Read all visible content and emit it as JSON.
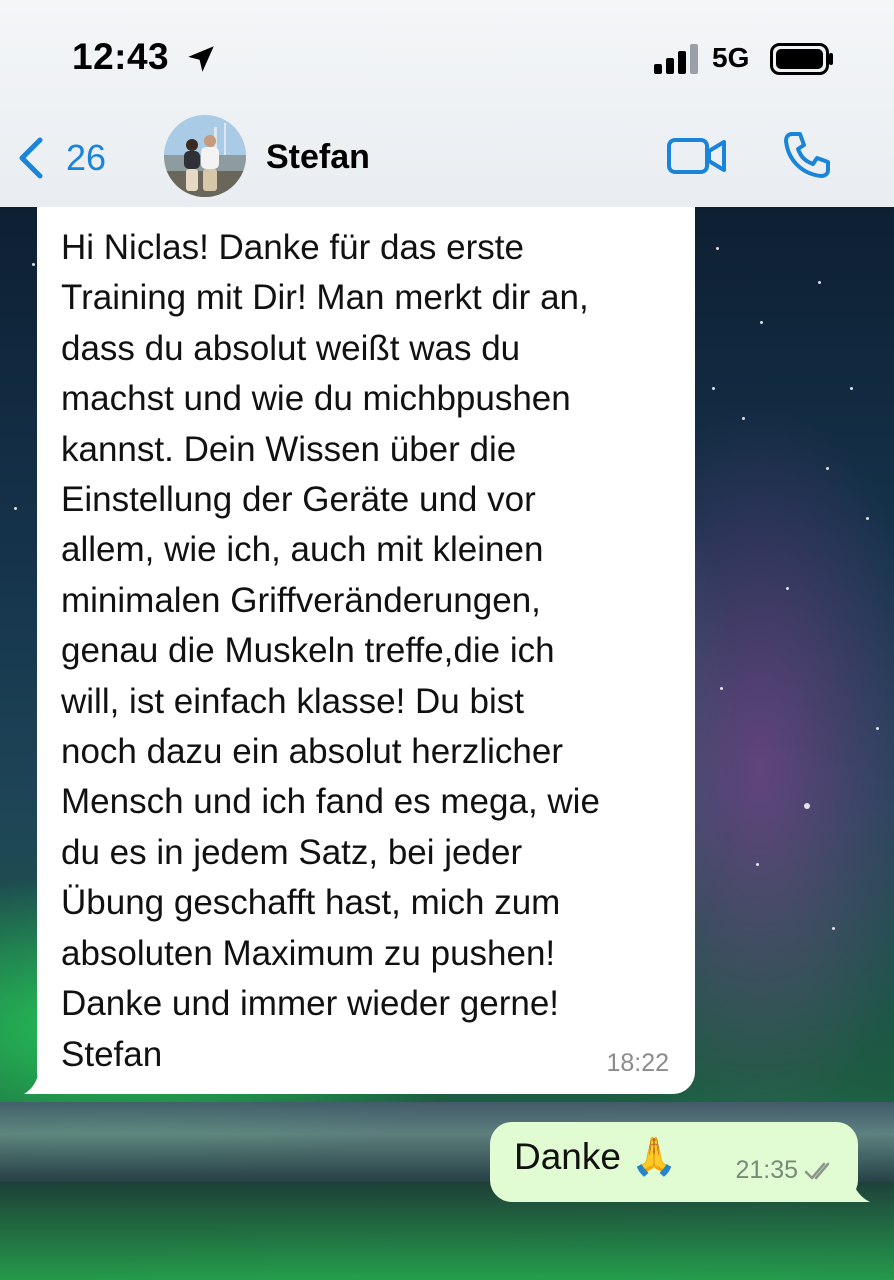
{
  "status_bar": {
    "time": "12:43",
    "network": "5G",
    "icons": [
      "location-arrow-icon",
      "signal-bars-icon",
      "battery-icon"
    ]
  },
  "header": {
    "back_count": "26",
    "contact_name": "Stefan",
    "icons": [
      "chevron-left-icon",
      "video-call-icon",
      "phone-icon"
    ],
    "accent_color": "#1a84d9"
  },
  "messages": [
    {
      "direction": "incoming",
      "text": "Hi Niclas! Danke für das erste\nTraining mit Dir! Man merkt dir an,\ndass du absolut weißt was du\nmachst und wie du michbpushen\nkannst. Dein Wissen über die\nEinstellung der Geräte und vor\nallem, wie ich, auch mit kleinen\nminimalen Griffveränderungen,\ngenau die Muskeln treffe,die ich\nwill, ist einfach klasse! Du bist\nnoch dazu ein absolut herzlicher\nMensch und ich fand es mega, wie\ndu es in jedem Satz, bei jeder\nÜbung geschafft hast, mich zum\nabsoluten Maximum zu pushen!\nDanke und immer wieder gerne!\nStefan",
      "time": "18:22",
      "bubble_color": "#ffffff"
    },
    {
      "direction": "outgoing",
      "text": "Danke 🙏",
      "time": "21:35",
      "status_icon": "double-check-icon",
      "bubble_color": "#e1fcd3"
    }
  ]
}
